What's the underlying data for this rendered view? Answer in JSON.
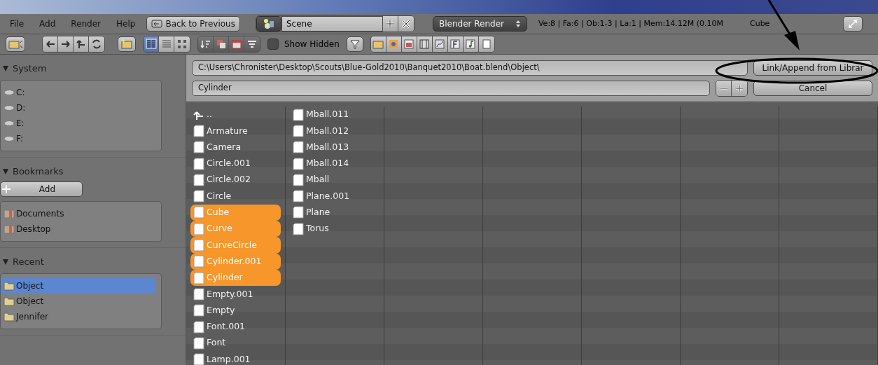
{
  "header": {
    "menu": [
      "File",
      "Add",
      "Render",
      "Help"
    ],
    "back_button": "Back to Previous",
    "scene": "Scene",
    "render_engine": "Blender Render",
    "stats": "Ve:8 | Fa:6 | Ob:1-3 | La:1 | Mem:14.12M (0.10M",
    "active_object": "Cube"
  },
  "toolbar": {
    "display_modes": [
      {
        "selected": true
      },
      {
        "selected": false
      },
      {
        "selected": false
      }
    ],
    "show_hidden": {
      "label": "Show Hidden",
      "checked": false
    }
  },
  "sidebar": [
    {
      "title": "System",
      "expanded": true,
      "items": [
        {
          "label": "C:",
          "kind": "drive",
          "selected": false
        },
        {
          "label": "D:",
          "kind": "drive",
          "selected": false
        },
        {
          "label": "E:",
          "kind": "drive",
          "selected": false
        },
        {
          "label": "F:",
          "kind": "drive",
          "selected": false
        }
      ]
    },
    {
      "title": "Bookmarks",
      "expanded": true,
      "add_button": "Add",
      "items": [
        {
          "label": "Documents",
          "kind": "bookmark",
          "selected": false
        },
        {
          "label": "Desktop",
          "kind": "bookmark",
          "selected": false
        }
      ]
    },
    {
      "title": "Recent",
      "expanded": true,
      "items": [
        {
          "label": "Object",
          "kind": "folder",
          "selected": true
        },
        {
          "label": "Object",
          "kind": "folder",
          "selected": false
        },
        {
          "label": "Jennifer",
          "kind": "folder",
          "selected": false
        }
      ]
    }
  ],
  "path": "C:\\Users\\Chronister\\Desktop\\Scouts\\Blue-Gold2010\\Banquet2010\\Boat.blend\\Object\\",
  "filename": "Cylinder",
  "buttons": [
    "Link/Append from Librar",
    "Cancel"
  ],
  "files": [
    [
      {
        "name": "..",
        "kind": "parent",
        "selected": false
      },
      {
        "name": "Armature",
        "kind": "file",
        "selected": false
      },
      {
        "name": "Camera",
        "kind": "file",
        "selected": false
      },
      {
        "name": "Circle.001",
        "kind": "file",
        "selected": false
      },
      {
        "name": "Circle.002",
        "kind": "file",
        "selected": false
      },
      {
        "name": "Circle",
        "kind": "file",
        "selected": false
      },
      {
        "name": "Cube",
        "kind": "file",
        "selected": true
      },
      {
        "name": "Curve",
        "kind": "file",
        "selected": true
      },
      {
        "name": "CurveCircle",
        "kind": "file",
        "selected": true
      },
      {
        "name": "Cylinder.001",
        "kind": "file",
        "selected": true
      },
      {
        "name": "Cylinder",
        "kind": "file",
        "selected": true
      },
      {
        "name": "Empty.001",
        "kind": "file",
        "selected": false
      },
      {
        "name": "Empty",
        "kind": "file",
        "selected": false
      },
      {
        "name": "Font.001",
        "kind": "file",
        "selected": false
      },
      {
        "name": "Font",
        "kind": "file",
        "selected": false
      },
      {
        "name": "Lamp.001",
        "kind": "file",
        "selected": false
      }
    ],
    [
      {
        "name": "Mball.011",
        "kind": "file",
        "selected": false
      },
      {
        "name": "Mball.012",
        "kind": "file",
        "selected": false
      },
      {
        "name": "Mball.013",
        "kind": "file",
        "selected": false
      },
      {
        "name": "Mball.014",
        "kind": "file",
        "selected": false
      },
      {
        "name": "Mball",
        "kind": "file",
        "selected": false
      },
      {
        "name": "Plane.001",
        "kind": "file",
        "selected": false
      },
      {
        "name": "Plane",
        "kind": "file",
        "selected": false
      },
      {
        "name": "Torus",
        "kind": "file",
        "selected": false
      }
    ]
  ]
}
